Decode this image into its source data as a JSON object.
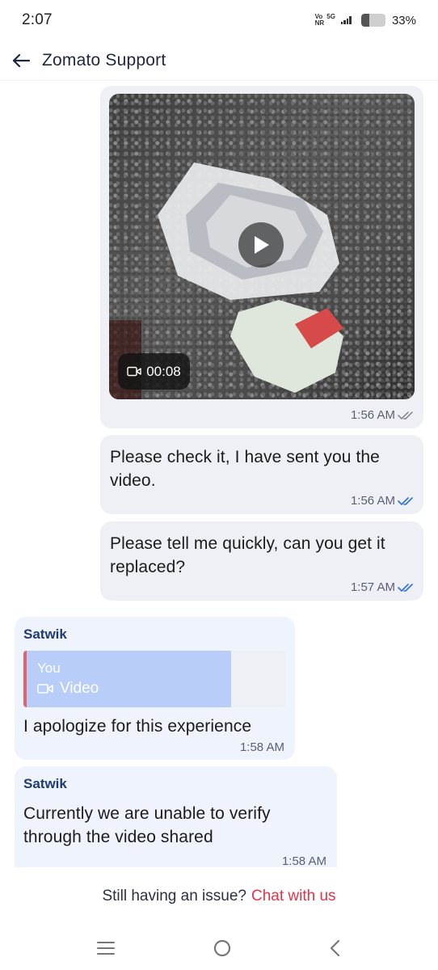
{
  "status_bar": {
    "time": "2:07",
    "network_top_left": "Vo",
    "network_top_right": "5G",
    "network_bottom": "NR",
    "battery_percent": "33%",
    "battery_level": 0.33
  },
  "header": {
    "back_icon": "arrow-left-icon",
    "title": "Zomato Support"
  },
  "messages": {
    "video": {
      "duration": "00:08",
      "time": "1:56 AM",
      "status": "delivered"
    },
    "check": {
      "text": "Please check it, I have sent you the video.",
      "time": "1:56 AM",
      "status": "read"
    },
    "replace": {
      "text": "Please tell me quickly, can you get it replaced?",
      "time": "1:57 AM",
      "status": "read"
    },
    "apology": {
      "sender": "Satwik",
      "quote_author": "You",
      "quote_type": "Video",
      "text": "I apologize for this experience",
      "time": "1:58 AM"
    },
    "verify": {
      "sender": "Satwik",
      "text": "Currently we are unable to verify through the video shared",
      "time": "1:58 AM"
    }
  },
  "footer": {
    "prompt": "Still having an issue?",
    "link": "Chat with us"
  },
  "navbar": {
    "icons": [
      "menu-icon",
      "home-icon",
      "back-icon"
    ]
  },
  "colors": {
    "accent_red": "#e03546",
    "read_tick_blue": "#2f6fd6",
    "sender_name": "#1f3b73"
  }
}
